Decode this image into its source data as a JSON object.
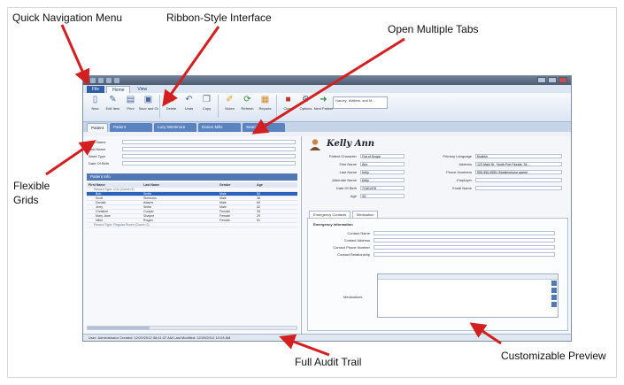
{
  "callouts": {
    "quick_nav": "Quick Navigation Menu",
    "ribbon": "Ribbon-Style Interface",
    "tabs": "Open Multiple Tabs",
    "grids_line1": "Flexible",
    "grids_line2": "Grids",
    "audit": "Full Audit Trail",
    "preview": "Customizable Preview"
  },
  "app": {
    "menu_tabs": [
      "File",
      "Home",
      "View"
    ],
    "ribbon_buttons": [
      {
        "label": "New",
        "icon": "new-document-icon"
      },
      {
        "label": "Edit Item",
        "icon": "edit-icon"
      },
      {
        "label": "Print",
        "icon": "printer-icon"
      },
      {
        "label": "Save and Close",
        "icon": "save-close-icon"
      },
      {
        "label": "Delete",
        "icon": "delete-icon"
      },
      {
        "label": "Undo",
        "icon": "undo-icon"
      },
      {
        "label": "Copy",
        "icon": "copy-icon"
      },
      {
        "label": "Notes",
        "icon": "notes-icon"
      },
      {
        "label": "Refresh",
        "icon": "refresh-icon"
      },
      {
        "label": "Reports",
        "icon": "reports-icon"
      },
      {
        "label": "Close",
        "icon": "close-icon"
      },
      {
        "label": "Options",
        "icon": "options-icon"
      },
      {
        "label": "Next Patient",
        "icon": "next-icon"
      }
    ],
    "ribbon_box_text": "Harvey, Walters, and M...",
    "doc_tabs": [
      "Patient",
      "Patient",
      "Lucy Westmore",
      "Darien Mills",
      "Search"
    ],
    "filter_labels": [
      "First Name",
      "Last Name",
      "Ward Type",
      "Date Of Birth"
    ],
    "grid_title": "Patient Info",
    "grid_headers": [
      "First Name",
      "Last Name",
      "Gender",
      "Age"
    ],
    "grid_rows": [
      {
        "first": "Bob",
        "last": "Smith",
        "gender": "Male",
        "age": "54",
        "selected": true
      },
      {
        "first": "Scott",
        "last": "Simmons",
        "gender": "Male",
        "age": "38",
        "selected": false
      },
      {
        "first": "Donald",
        "last": "Adams",
        "gender": "Male",
        "age": "60",
        "selected": false
      },
      {
        "first": "Jerry",
        "last": "Smith",
        "gender": "Male",
        "age": "42",
        "selected": false
      },
      {
        "first": "Christine",
        "last": "Cooper",
        "gender": "Female",
        "age": "35",
        "selected": false
      },
      {
        "first": "Mary Jane",
        "last": "Shayne",
        "gender": "Female",
        "age": "29",
        "selected": false
      },
      {
        "first": "Nikki",
        "last": "Rogan",
        "gender": "Female",
        "age": "51",
        "selected": false
      }
    ],
    "grid_groups": [
      "Record Type: ICU (Count=2)",
      "Record Type: Regular Room (Count=2)"
    ],
    "patient_name": "Kelly Ann",
    "detail_left": [
      {
        "label": "Patient Character",
        "value": "Out of Scope"
      },
      {
        "label": "First Name",
        "value": "Ann"
      },
      {
        "label": "Last Name",
        "value": "Kelly"
      },
      {
        "label": "Alternate Name",
        "value": "Kelly"
      },
      {
        "label": "Date Of Birth",
        "value": "7/16/1976"
      },
      {
        "label": "Age",
        "value": "34"
      }
    ],
    "detail_right": [
      {
        "label": "Primary Language",
        "value": "English"
      },
      {
        "label": "Address",
        "value": "123 Main St., North Port Florida, 34..."
      },
      {
        "label": "Phone Numbers",
        "value": "555-555-5555 (Mobile/phone agent)"
      },
      {
        "label": "Employer",
        "value": ""
      },
      {
        "label": "Email Name",
        "value": ""
      }
    ],
    "sub_tabs": [
      "Emergency Contacts",
      "Medication"
    ],
    "subpanel_title": "Emergency Information",
    "subpanel_fields": [
      "Contact Name",
      "Contact Address",
      "Contact Phone Number",
      "Contact Relationship"
    ],
    "notes_label": "Medications",
    "status_text": "User: Administrator   Created: 12/29/2012 08:41:37 AM   Last Modified: 12/29/2012 10:03 AM"
  }
}
